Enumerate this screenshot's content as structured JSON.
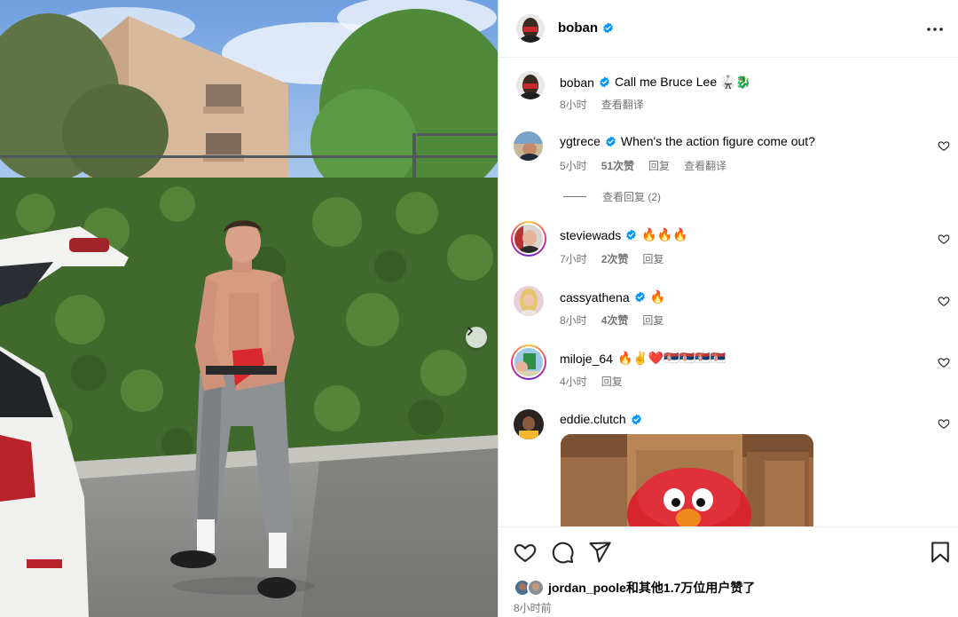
{
  "post": {
    "author": "boban",
    "more_icon": "more-horizontal-icon",
    "caption": {
      "username": "boban",
      "text": "Call me Bruce Lee 🥋🐉",
      "time": "8小时",
      "translate": "查看翻译"
    }
  },
  "comments": [
    {
      "username": "ygtrece",
      "text": "When's the action figure come out?",
      "time": "5小时",
      "likes": "51次赞",
      "reply": "回复",
      "translate": "查看翻译"
    },
    {
      "username": "steviewads",
      "text": "🔥🔥🔥",
      "time": "7小时",
      "likes": "2次赞",
      "reply": "回复"
    },
    {
      "username": "cassyathena",
      "text": "🔥",
      "time": "8小时",
      "likes": "4次赞",
      "reply": "回复"
    },
    {
      "username": "miloje_64",
      "text": "🔥✌️❤️🇷🇸🇷🇸🇷🇸🇷🇸",
      "time": "4小时",
      "reply": "回复"
    },
    {
      "username": "eddie.clutch",
      "text": ""
    }
  ],
  "view_replies": "查看回复 (2)",
  "likes_summary": {
    "user": "jordan_poole",
    "suffix": "和其他1.7万位用户赞了"
  },
  "posted_ago": "8小时前",
  "colors": {
    "verified": "#0095f6",
    "meta": "#737373",
    "divider": "#efefef"
  }
}
